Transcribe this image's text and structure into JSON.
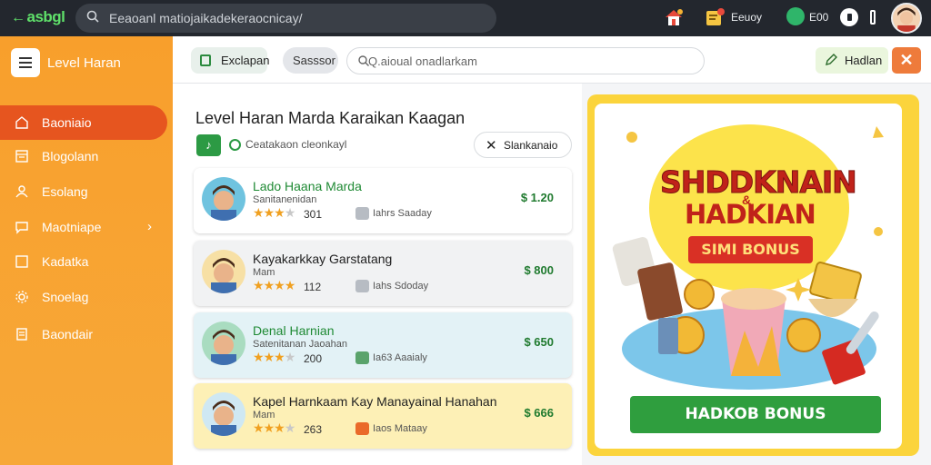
{
  "topbar": {
    "logo": "asbgl",
    "search_text": "Eeaoanl matiojaikadekeraocnicay/",
    "wallet_label": "Eeuoy",
    "coin_label": "E00"
  },
  "sidebar": {
    "title": "Level Haran",
    "items": [
      {
        "label": "Baoniaio",
        "icon": "home-icon",
        "active": true
      },
      {
        "label": "Blogolann",
        "icon": "calendar-icon"
      },
      {
        "label": "Esolang",
        "icon": "person-icon"
      },
      {
        "label": "Maotniape",
        "icon": "chat-icon",
        "has_chevron": true
      },
      {
        "label": "Kadatka",
        "icon": "square-icon"
      },
      {
        "label": "Snoelag",
        "icon": "gear-icon"
      },
      {
        "label": "Baondair",
        "icon": "document-icon"
      }
    ]
  },
  "toolbar": {
    "evaluation_label": "Exclapan",
    "session_label": "Sasssor",
    "field_text": "Q.aioual onadlarkam",
    "header_label": "Hadlan",
    "close_label": "✕"
  },
  "main": {
    "title": "Level Haran Marda Karaikan Kaagan",
    "chip_label": "♪",
    "subtitle": "Ceatakaon cleonkayl",
    "filter_label": "Slankanaio",
    "rows": [
      {
        "name": "Lado Haana Marda",
        "meta": "Sanitanenidan",
        "rating": "301",
        "stars": 3,
        "tag": "Iahrs Saaday",
        "price": "$ 1.20",
        "bg": "#ffffff",
        "name_color": "#1f8a34",
        "tag_color": "#b7bcc3"
      },
      {
        "name": "Kayakarkkay Garstatang",
        "meta": "Mam",
        "rating": "112",
        "stars": 4,
        "tag": "Iahs Sdoday",
        "price": "$ 800",
        "bg": "#f1f2f3",
        "name_color": "#222222",
        "tag_color": "#b7bcc3"
      },
      {
        "name": "Denal Harnian",
        "meta": "Satenitanan Jaoahan",
        "rating": "200",
        "stars": 3,
        "tag": "Ia63 Aaaialy",
        "price": "$ 650",
        "bg": "#e3f2f6",
        "name_color": "#1f8a34",
        "tag_color": "#5aa36b"
      },
      {
        "name": "Kapel Harnkaam Kay Manayainal Hanahan",
        "meta": "Mam",
        "rating": "263",
        "stars": 3,
        "tag": "Iaos Mataay",
        "price": "$ 666",
        "bg": "#fdf0b6",
        "name_color": "#222222",
        "tag_color": "#ea6a2a"
      }
    ]
  },
  "promo": {
    "title_line1": "SHDDKNAIN",
    "amp": "&",
    "title_line2": "HADKIAN",
    "ribbon": "SIMI BONUS",
    "cta": "HADKOB BONUS"
  },
  "colors": {
    "sidebar": "#f89f2c",
    "active_item": "#e6551f",
    "topbar": "#23272e",
    "price": "#1f7a2e",
    "promo_cta": "#2f9e3e",
    "promo_title": "#c0221a"
  }
}
